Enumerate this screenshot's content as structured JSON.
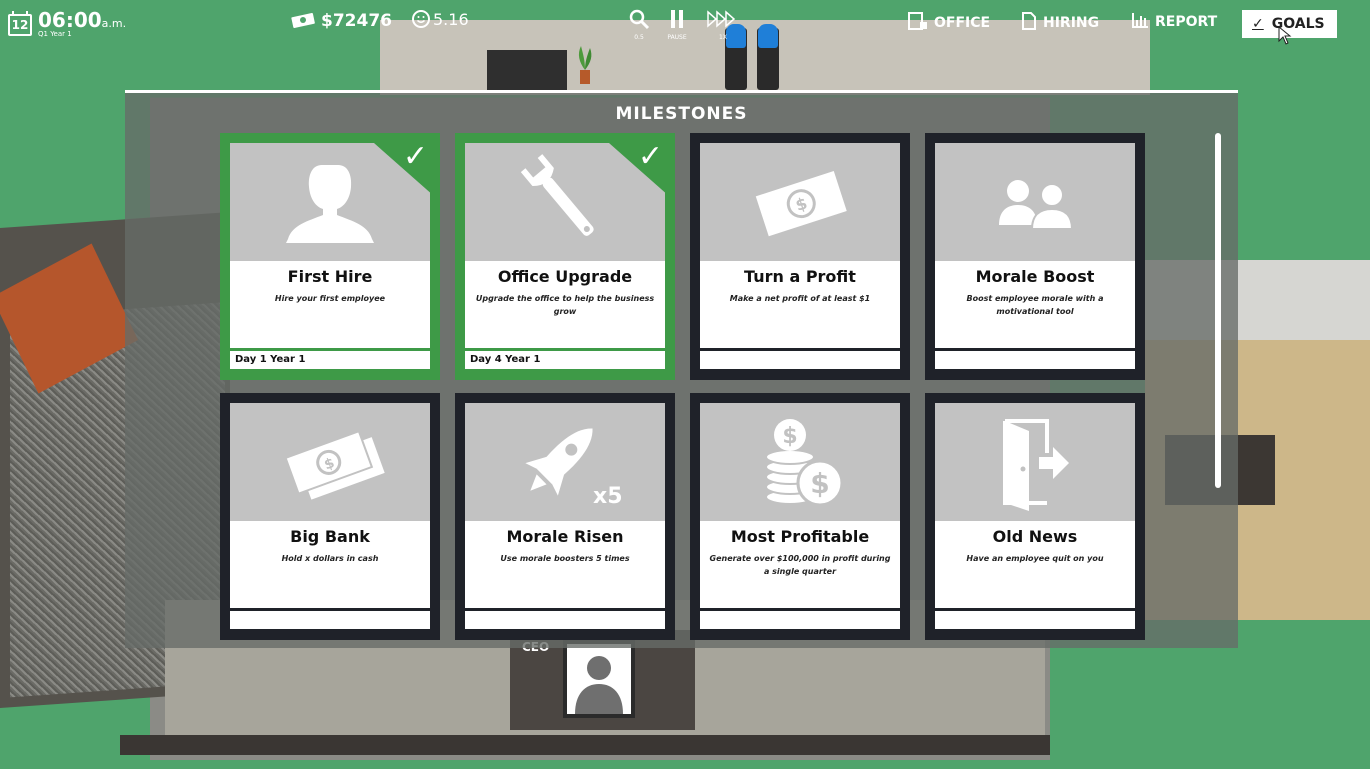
{
  "hud": {
    "day": "12",
    "time": "06:00",
    "ampm": "a.m.",
    "period": "Q1 Year 1",
    "money": "$72476",
    "happiness": "5.16",
    "controls": [
      {
        "icon": "magnifier-icon",
        "label": "0.5"
      },
      {
        "icon": "pause-icon",
        "label": "PAUSE"
      },
      {
        "icon": "fast-forward-icon",
        "label": "1X"
      }
    ],
    "nav": {
      "office": "OFFICE",
      "hiring": "HIRING",
      "report": "REPORT",
      "goals": "GOALS"
    }
  },
  "scene": {
    "ceo_label": "CEO"
  },
  "milestones": {
    "title": "MILESTONES",
    "cards": [
      {
        "title": "First Hire",
        "desc": "Hire your first employee",
        "date": "Day 1 Year 1",
        "done": true,
        "icon": "person-icon"
      },
      {
        "title": "Office Upgrade",
        "desc": "Upgrade the office to help the business grow",
        "date": "Day 4 Year 1",
        "done": true,
        "icon": "wrench-icon"
      },
      {
        "title": "Turn a Profit",
        "desc": "Make a net profit of at least $1",
        "date": "",
        "done": false,
        "icon": "dollar-bill-icon"
      },
      {
        "title": "Morale Boost",
        "desc": "Boost employee morale with a motivational tool",
        "date": "",
        "done": false,
        "icon": "two-people-icon"
      },
      {
        "title": "Big Bank",
        "desc": "Hold x dollars in cash",
        "date": "",
        "done": false,
        "icon": "money-stack-icon"
      },
      {
        "title": "Morale Risen",
        "desc": "Use morale boosters 5 times",
        "date": "",
        "done": false,
        "icon": "rocket-icon",
        "badge": "x5"
      },
      {
        "title": "Most Profitable",
        "desc": "Generate over $100,000 in profit during a single quarter",
        "date": "",
        "done": false,
        "icon": "coin-stack-icon"
      },
      {
        "title": "Old News",
        "desc": "Have an employee quit on you",
        "date": "",
        "done": false,
        "icon": "exit-door-icon"
      }
    ]
  }
}
